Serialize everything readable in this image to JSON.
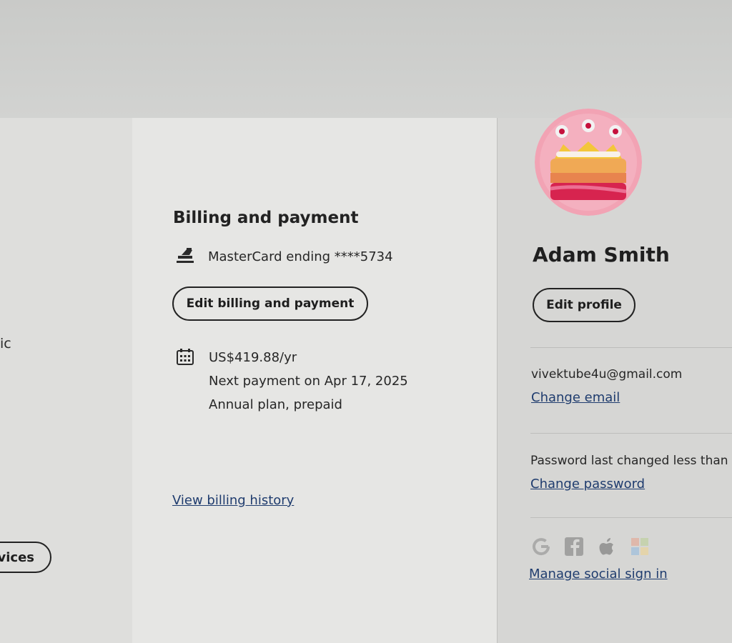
{
  "left": {
    "partial_label": "ic",
    "services_button_label": "rvices"
  },
  "billing": {
    "title": "Billing and payment",
    "card_text": "MasterCard ending ****5734",
    "edit_button_label": "Edit billing and payment",
    "price": "US$419.88/yr",
    "next_payment": "Next payment on Apr 17, 2025",
    "plan_type": "Annual plan, prepaid",
    "history_link": "View billing history"
  },
  "profile": {
    "name": "Adam Smith",
    "edit_button_label": "Edit profile",
    "email": "vivektube4u@gmail.com",
    "change_email_link": "Change email",
    "password_status": "Password last changed less than a",
    "change_password_link": "Change password",
    "social_icons": [
      "google-icon",
      "facebook-icon",
      "apple-icon",
      "microsoft-icon"
    ],
    "manage_social_link": "Manage social sign in"
  },
  "colors": {
    "link": "#1f3c6e",
    "avatar_bg": "#f2a3b4",
    "card_bg": "#e6e6e4"
  }
}
